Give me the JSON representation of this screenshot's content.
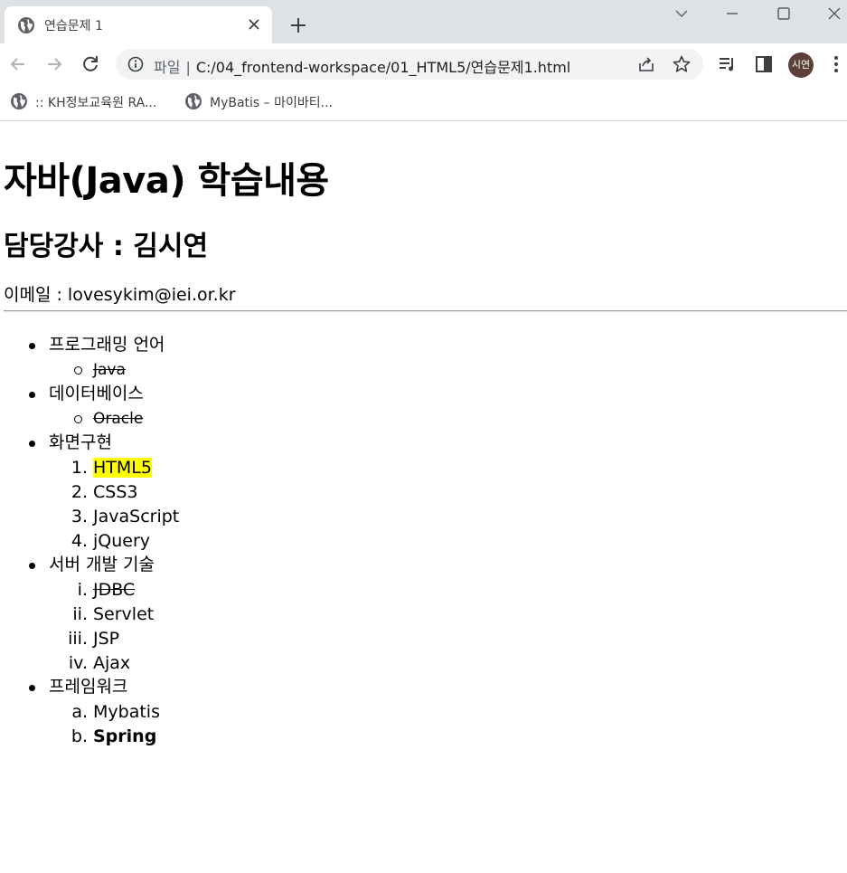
{
  "browser": {
    "tab_title": "연습문제 1",
    "url_scheme": "파일",
    "url": "C:/04_frontend-workspace/01_HTML5/연습문제1.html",
    "profile_initials": "시연",
    "bookmarks": [
      {
        "label": ":: KH정보교육원 RA..."
      },
      {
        "label": "MyBatis – 마이바티..."
      }
    ]
  },
  "page": {
    "title": "자바(Java) 학습내용",
    "subtitle": "담당강사 : 김시연",
    "email": "이메일 : lovesykim@iei.or.kr",
    "sections": [
      {
        "label": "프로그래밍 언어",
        "items": [
          {
            "marker": "",
            "text": "Java",
            "style": "strike"
          }
        ]
      },
      {
        "label": "데이터베이스",
        "items": [
          {
            "marker": "",
            "text": "Oracle",
            "style": "strike"
          }
        ]
      },
      {
        "label": "화면구현",
        "items": [
          {
            "marker": "1.",
            "text": "HTML5",
            "style": "mark"
          },
          {
            "marker": "2.",
            "text": "CSS3",
            "style": ""
          },
          {
            "marker": "3.",
            "text": "JavaScript",
            "style": ""
          },
          {
            "marker": "4.",
            "text": "jQuery",
            "style": ""
          }
        ]
      },
      {
        "label": "서버 개발 기술",
        "items": [
          {
            "marker": "i.",
            "text": "JDBC",
            "style": "strike"
          },
          {
            "marker": "ii.",
            "text": "Servlet",
            "style": ""
          },
          {
            "marker": "iii.",
            "text": "JSP",
            "style": ""
          },
          {
            "marker": "iv.",
            "text": "Ajax",
            "style": ""
          }
        ]
      },
      {
        "label": "프레임워크",
        "items": [
          {
            "marker": "a.",
            "text": "Mybatis",
            "style": ""
          },
          {
            "marker": "b.",
            "text": "Spring",
            "style": "bold"
          }
        ]
      }
    ]
  }
}
